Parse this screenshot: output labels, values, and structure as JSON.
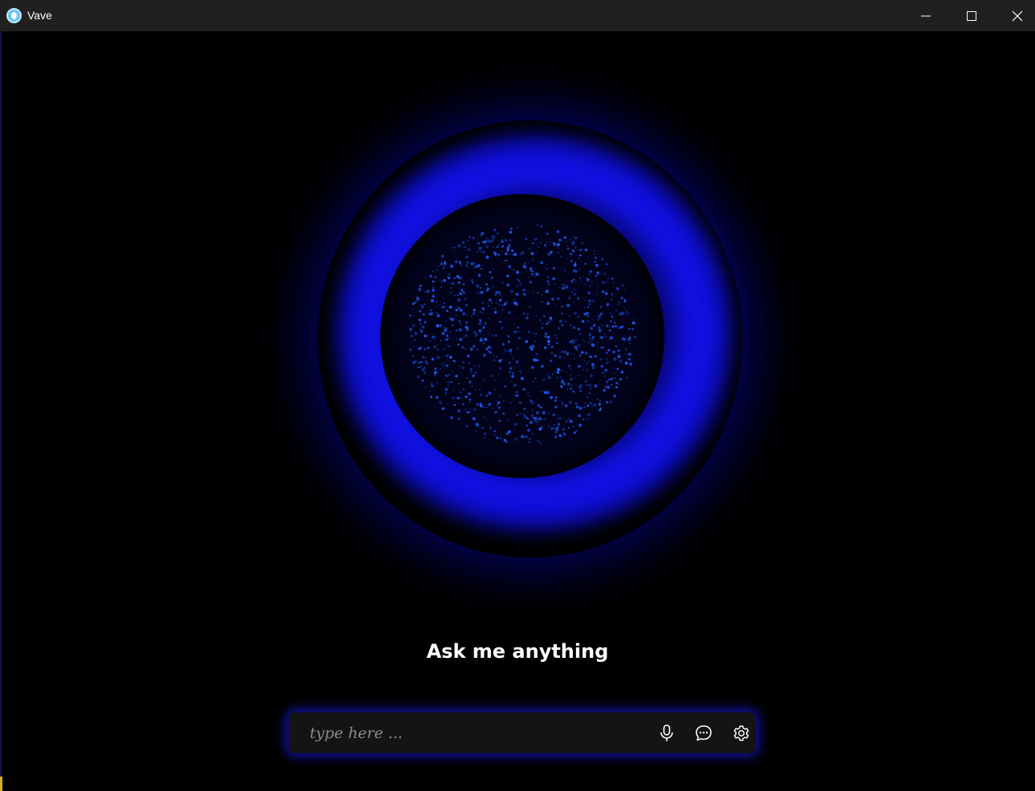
{
  "window": {
    "title": "Vave",
    "app_icon": "vave-app-icon",
    "controls": {
      "minimize_icon": "minimize-icon",
      "maximize_icon": "maximize-icon",
      "close_icon": "close-icon"
    }
  },
  "main": {
    "orb": {
      "ring_color": "#1414f0",
      "particle_color": "#1e56e8",
      "core_color": "#02021a"
    },
    "headline": "Ask me anything",
    "input": {
      "value": "",
      "placeholder": "type here ..."
    },
    "tools": [
      {
        "name": "microphone",
        "icon": "microphone-icon"
      },
      {
        "name": "chat",
        "icon": "chat-bubble-icon"
      },
      {
        "name": "settings",
        "icon": "gear-icon"
      }
    ]
  },
  "colors": {
    "titlebar_bg": "#202020",
    "window_bg": "#000000",
    "accent_glow": "#1919e6",
    "input_bg": "#141414"
  }
}
